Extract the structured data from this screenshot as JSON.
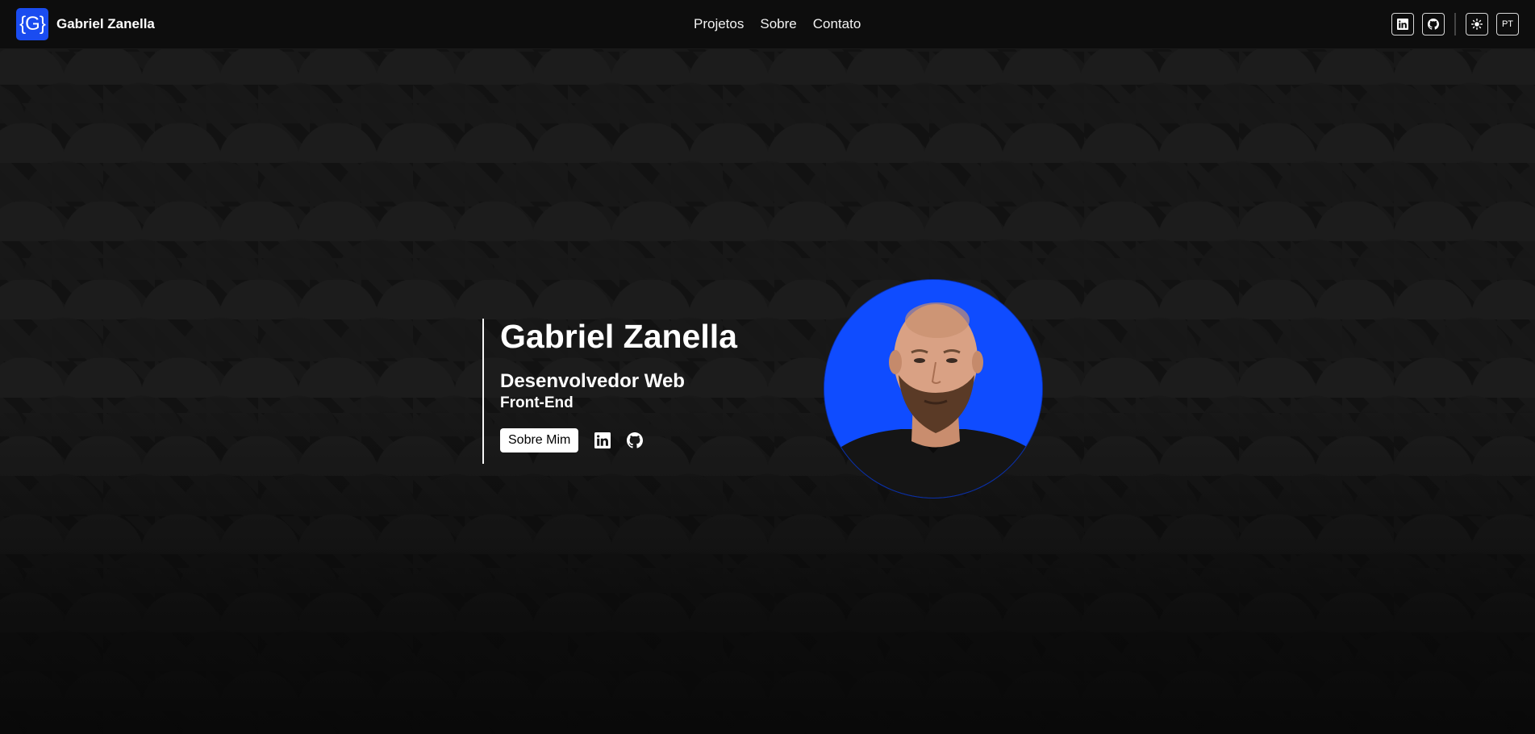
{
  "header": {
    "logo_text": "{G}",
    "brand_name": "Gabriel Zanella",
    "nav": [
      {
        "label": "Projetos"
      },
      {
        "label": "Sobre"
      },
      {
        "label": "Contato"
      }
    ],
    "actions": {
      "linkedin_icon": "linkedin-icon",
      "github_icon": "github-icon",
      "theme_icon": "sun-icon",
      "language_label": "PT"
    }
  },
  "hero": {
    "name": "Gabriel Zanella",
    "role": "Desenvolvedor Web",
    "subrole": "Front-End",
    "about_button": "Sobre Mim"
  },
  "colors": {
    "accent": "#1a4cf0",
    "avatar_bg": "#0f4cff",
    "background": "#121212"
  }
}
